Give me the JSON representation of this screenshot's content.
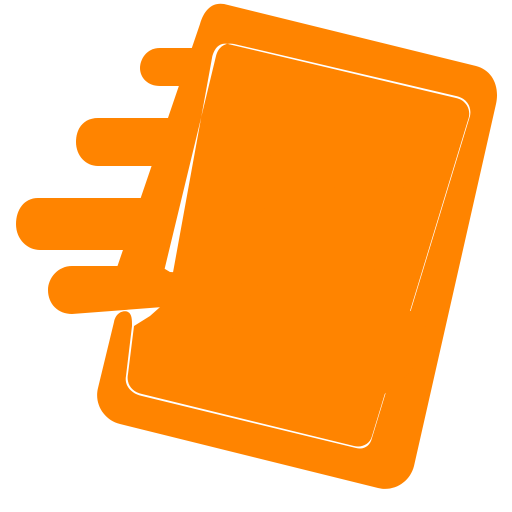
{
  "icon": {
    "name": "tap-phone-icon",
    "description_visible": "",
    "color": "#ff8400",
    "background": "#ffffff"
  }
}
